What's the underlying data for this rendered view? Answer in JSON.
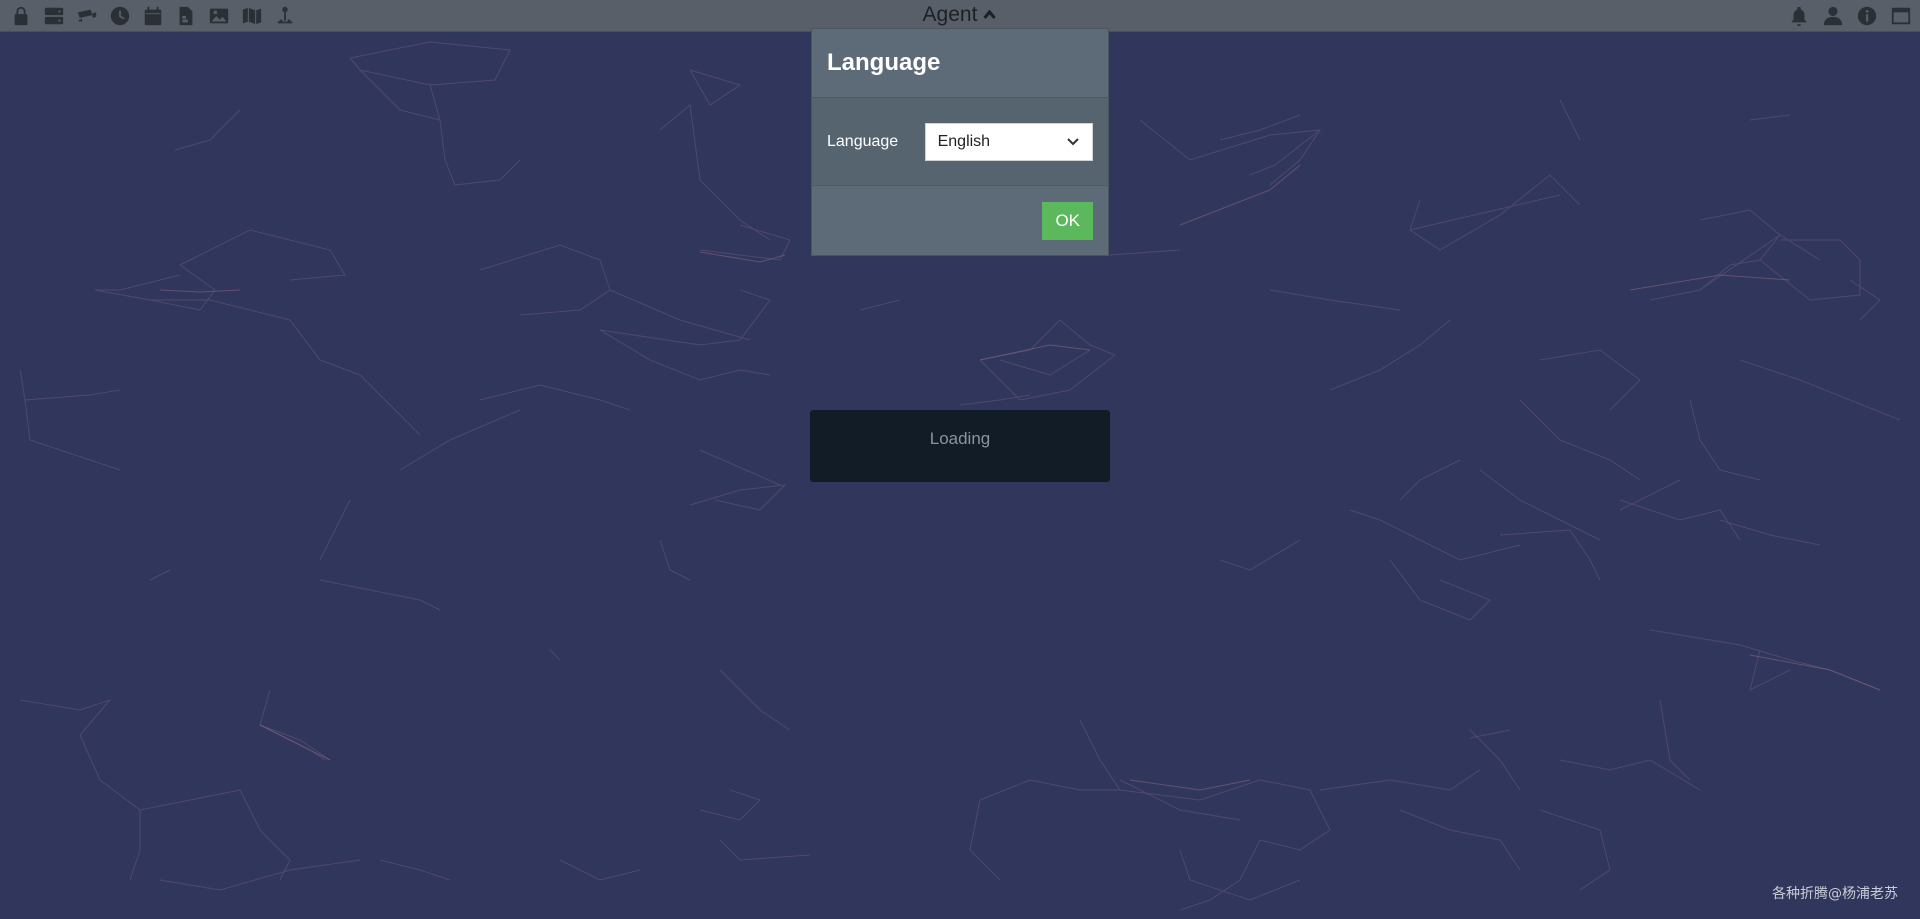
{
  "topbar": {
    "left_icons": [
      {
        "name": "lock-icon"
      },
      {
        "name": "server-icon"
      },
      {
        "name": "camera-icon"
      },
      {
        "name": "clock-icon"
      },
      {
        "name": "calendar-icon"
      },
      {
        "name": "file-icon"
      },
      {
        "name": "image-icon"
      },
      {
        "name": "map-icon"
      },
      {
        "name": "location-icon"
      }
    ],
    "center_label": "Agent",
    "right_icons": [
      {
        "name": "bell-icon"
      },
      {
        "name": "user-icon"
      },
      {
        "name": "info-icon"
      },
      {
        "name": "window-icon"
      }
    ]
  },
  "dialog": {
    "title": "Language",
    "field_label": "Language",
    "select_value": "English",
    "ok_label": "OK"
  },
  "loading": {
    "text": "Loading"
  },
  "watermark": "各种折腾@杨浦老苏",
  "colors": {
    "background": "#31365c",
    "topbar": "#595f69",
    "dialog": "#5d6b78",
    "ok_button": "#5cb85c",
    "loading_box": "#121c27"
  }
}
